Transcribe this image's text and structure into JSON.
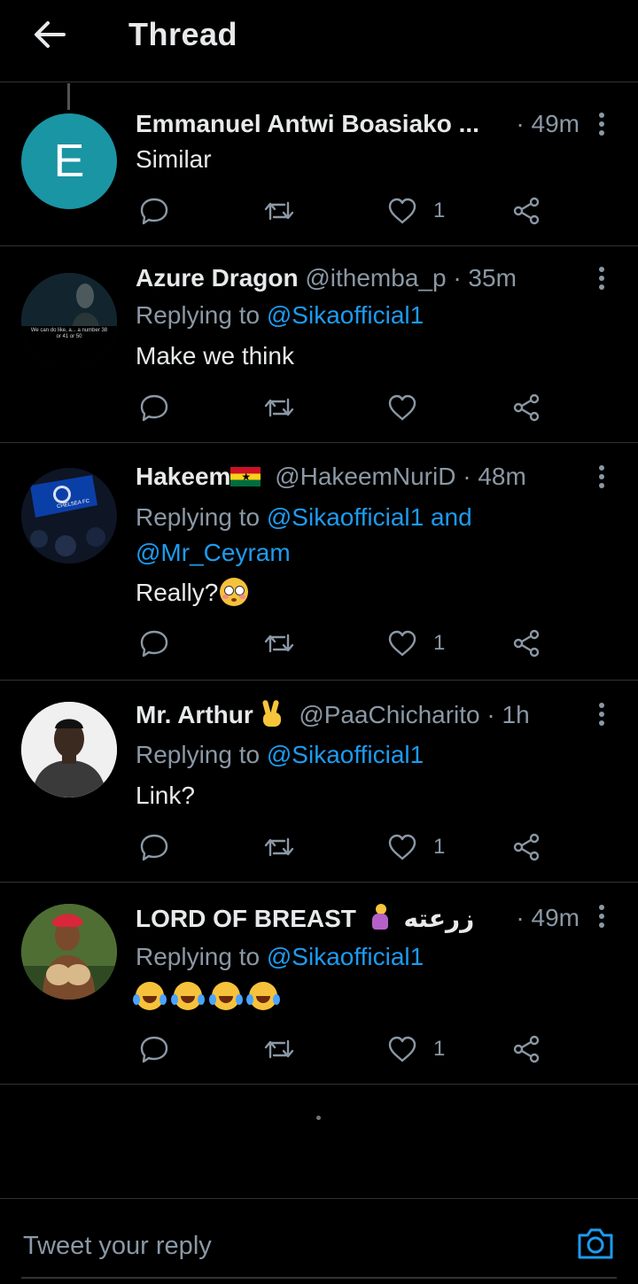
{
  "header": {
    "title": "Thread"
  },
  "tweets": [
    {
      "name": "Emmanuel Antwi Boasiako ...",
      "time": "· 49m",
      "text": "Similar",
      "like_count": "1",
      "avatar_letter": "E"
    },
    {
      "name": "Azure Dragon",
      "handle": "@ithemba_p",
      "time": "· 35m",
      "replying_prefix": "Replying to ",
      "replying_to": "@Sikaofficial1",
      "text": "Make we think",
      "like_count": "",
      "avatar_caption": "We can do like, a... a number 38 or 41 or 50"
    },
    {
      "name": "Hakeem",
      "handle": "@HakeemNuriD",
      "time": "· 48m",
      "replying_prefix": "Replying to ",
      "replying_to": "@Sikaofficial1",
      "replying_and": " and",
      "replying_to_2": "@Mr_Ceyram",
      "text": "Really?",
      "like_count": "1",
      "flag_text": "CHELSEA FC"
    },
    {
      "name": "Mr. Arthur",
      "handle": "@PaaChicharito",
      "time": "· 1h",
      "replying_prefix": "Replying to ",
      "replying_to": "@Sikaofficial1",
      "text": "Link?",
      "like_count": "1"
    },
    {
      "name": "LORD OF BREAST",
      "name_suffix": "زرعته ...",
      "time": "· 49m",
      "replying_prefix": "Replying to ",
      "replying_to": "@Sikaofficial1",
      "text": "",
      "like_count": "1"
    }
  ],
  "reply": {
    "placeholder": "Tweet your reply"
  },
  "colors": {
    "accent": "#1d9bf0",
    "background": "#000000",
    "secondary_text": "#8b98a5",
    "divider": "#2f3336"
  }
}
